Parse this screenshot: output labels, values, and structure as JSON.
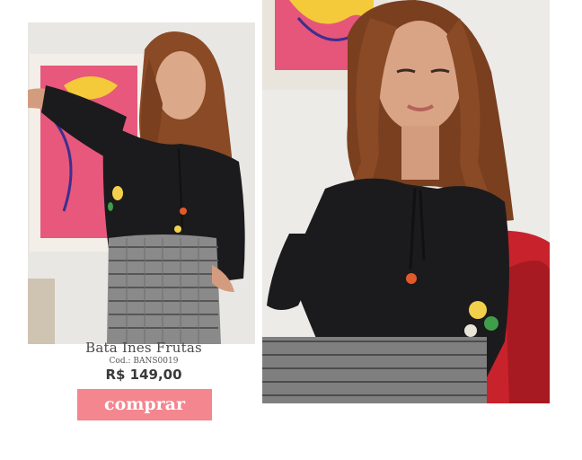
{
  "product": {
    "name": "Bata Ines Frutas",
    "code": "Cod.: BANS0019",
    "price": "R$ 149,00",
    "buy_label": "comprar"
  },
  "colors": {
    "buy_button": "#f4868f",
    "blouse": "#1b1b1d",
    "hair": "#8a4a26",
    "artwork_pink": "#ea5a78"
  }
}
